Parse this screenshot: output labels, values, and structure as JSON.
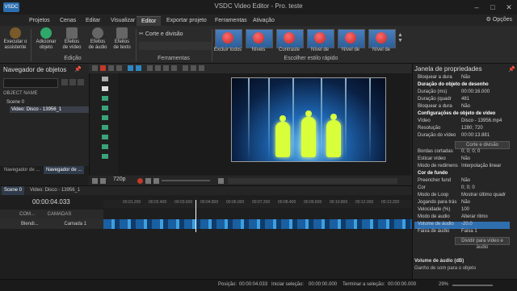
{
  "window": {
    "title": "VSDC Video Editor - Pro. teste",
    "logo_text": "VSDC"
  },
  "menu": {
    "items": [
      "Projetos",
      "Cenas",
      "Editar",
      "Visualizar",
      "Editor",
      "Exportar projeto",
      "Ferramentas",
      "Ativação"
    ],
    "active": "Editor",
    "options": "Opções"
  },
  "ribbon": {
    "buttons": [
      {
        "label1": "Executar o",
        "label2": "assistente"
      },
      {
        "label1": "Adicionar",
        "label2": "objeto"
      },
      {
        "label1": "Efeitos",
        "label2": "de vídeo"
      },
      {
        "label1": "Efeitos",
        "label2": "de áudio"
      },
      {
        "label1": "Efeitos",
        "label2": "de texto"
      }
    ],
    "corte": "Corte e divisão",
    "group_edicao": "Edição",
    "group_ferramentas": "Ferramentas",
    "group_estilo": "Escolher estilo rápido",
    "styles": [
      "Excluir todos",
      "Níveis",
      "Contraste",
      "Nível de",
      "Nível de",
      "Nível de"
    ]
  },
  "objnav": {
    "title": "Navegador de objetos",
    "column": "OBJECT NAME",
    "scene": "Scene 0",
    "video": "Video: Disco - 13956_1",
    "tab1": "Navegador de ...",
    "tab2": "Navegador de ..."
  },
  "preview": {
    "zoom": "720p"
  },
  "timeline": {
    "tab_scene": "Scene 0",
    "tab_video": "Video: Disco - 13956_1",
    "timecode": "00:00:04.033",
    "ticks": [
      "00:01.200",
      "00:02.400",
      "00:03.600",
      "00:04.800",
      "00:06.000",
      "00:07.200",
      "00:08.400",
      "00:09.600",
      "00:10.800",
      "00:12.000",
      "00:13.200"
    ],
    "layer_row": [
      "COM...",
      "CAMADAS"
    ],
    "track_mode": "Blendi...",
    "track_name": "Camada 1"
  },
  "props": {
    "title": "Janela de propriedades",
    "rows": [
      {
        "k": "Bloquear a dura",
        "v": "Não"
      },
      {
        "k": "Duração do objeto de desenho",
        "v": "",
        "sec": true
      },
      {
        "k": "Duração (ms)",
        "v": "00:00:16.000"
      },
      {
        "k": "Duração (quadr",
        "v": "481"
      },
      {
        "k": "Bloquear a dura",
        "v": "Não"
      },
      {
        "k": "Configurações de objeto de vídeo",
        "v": "",
        "sec": true
      },
      {
        "k": "Vídeo",
        "v": "Disco - 13956.mp4"
      },
      {
        "k": "Resolução",
        "v": "1280; 720"
      },
      {
        "k": "Duração do vídeo",
        "v": "00:00:13.881"
      }
    ],
    "btn1": "Corte e divisão",
    "rows2": [
      {
        "k": "Bordas cortadas",
        "v": "0; 0; 0; 0"
      },
      {
        "k": "Esticar vídeo",
        "v": "Não"
      },
      {
        "k": "Modo de redimens",
        "v": "Interpolação linear"
      },
      {
        "k": "Cor de fundo",
        "v": "",
        "sec": true
      },
      {
        "k": "Preencher fund",
        "v": "Não"
      },
      {
        "k": "Cor",
        "v": "0; 0; 0"
      },
      {
        "k": "Modo de Loop",
        "v": "Mostrar último quadr"
      },
      {
        "k": "Jogando para trás",
        "v": "Não"
      },
      {
        "k": "Velocidade (%)",
        "v": "100"
      },
      {
        "k": "Modo de audio",
        "v": "Alterar ritmo"
      },
      {
        "k": "Volume de áudio",
        "v": "-20.0",
        "hl": true
      },
      {
        "k": "Faixa de áudio",
        "v": "Faixa 1"
      }
    ],
    "btn2": "Dividir para vídeo e áudio",
    "desc_title": "Volume de áudio (dB)",
    "desc": "Ganho de som para o objeto"
  },
  "status": {
    "position_label": "Posição:",
    "position": "00:00:04.033",
    "sel_start_label": "Iniciar seleção:",
    "sel_start": "00:00:00.000",
    "sel_end_label": "Terminar a seleção:",
    "sel_end": "00:00:00.000",
    "zoom": "29%"
  }
}
